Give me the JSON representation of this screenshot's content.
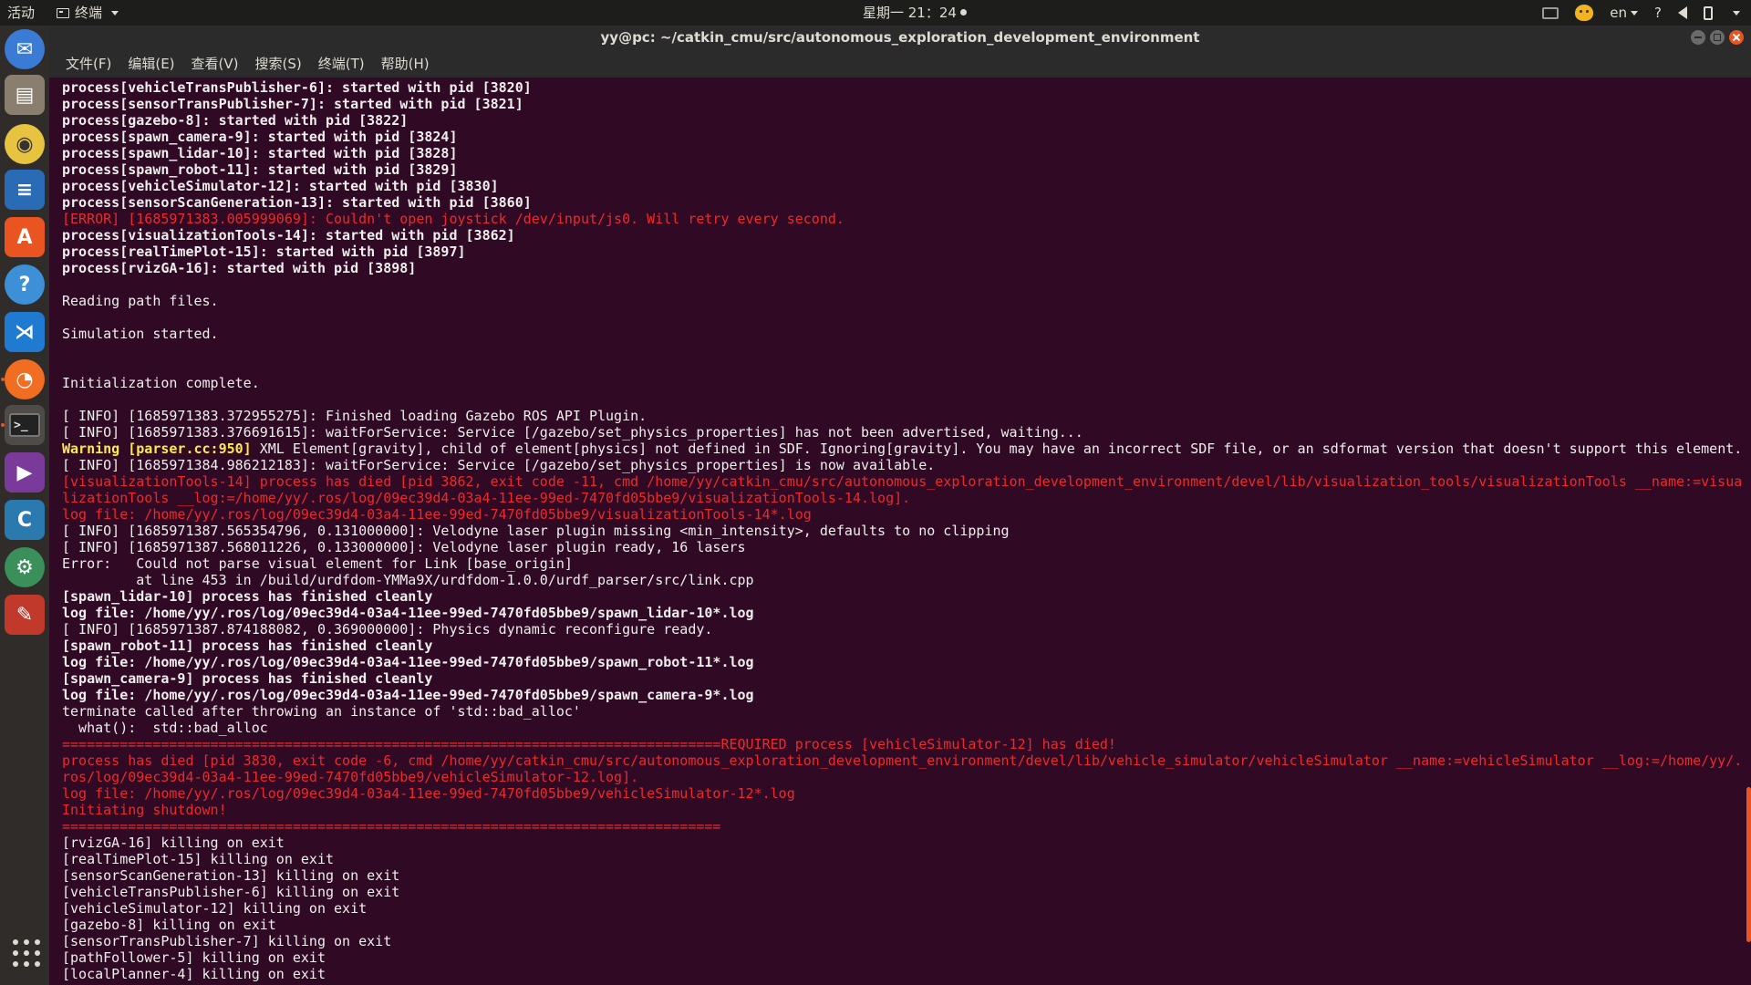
{
  "top_panel": {
    "activities": "活动",
    "app_name": "终端",
    "clock": "星期一 21：24",
    "input_method": "en",
    "help_symbol": "?"
  },
  "dock": {
    "items": [
      {
        "name": "thunderbird-icon",
        "color": "#3a7bd5"
      },
      {
        "name": "files-icon",
        "color": "#8a7f6f"
      },
      {
        "name": "rhythmbox-icon",
        "color": "#e8c340"
      },
      {
        "name": "libreoffice-writer-icon",
        "color": "#2a6bb5"
      },
      {
        "name": "software-center-icon",
        "color": "#e95420"
      },
      {
        "name": "help-icon",
        "color": "#3d8fd8"
      },
      {
        "name": "vscode-icon",
        "color": "#1f7bd1"
      },
      {
        "name": "firefox-icon",
        "color": "#f06d22"
      },
      {
        "name": "terminal-icon",
        "color": "#222222"
      },
      {
        "name": "video-app-icon",
        "color": "#7a3a9a"
      },
      {
        "name": "c-app-icon",
        "color": "#2a7ab0"
      },
      {
        "name": "settings-icon",
        "color": "#3a8f5a"
      },
      {
        "name": "tools-icon",
        "color": "#c0392b"
      }
    ],
    "show_apps": "show-applications"
  },
  "window": {
    "title": "yy@pc: ~/catkin_cmu/src/autonomous_exploration_development_environment"
  },
  "menu": [
    "文件(F)",
    "编辑(E)",
    "查看(V)",
    "搜索(S)",
    "终端(T)",
    "帮助(H)"
  ],
  "terminal": {
    "lines": [
      {
        "text": "process[vehicleTransPublisher-6]: started with pid [3820]",
        "style": "bold"
      },
      {
        "text": "process[sensorTransPublisher-7]: started with pid [3821]",
        "style": "bold"
      },
      {
        "text": "process[gazebo-8]: started with pid [3822]",
        "style": "bold"
      },
      {
        "text": "process[spawn_camera-9]: started with pid [3824]",
        "style": "bold"
      },
      {
        "text": "process[spawn_lidar-10]: started with pid [3828]",
        "style": "bold"
      },
      {
        "text": "process[spawn_robot-11]: started with pid [3829]",
        "style": "bold"
      },
      {
        "text": "process[vehicleSimulator-12]: started with pid [3830]",
        "style": "bold"
      },
      {
        "text": "process[sensorScanGeneration-13]: started with pid [3860]",
        "style": "bold"
      },
      {
        "text": "[ERROR] [1685971383.005999069]: Couldn't open joystick /dev/input/js0. Will retry every second.",
        "style": "err"
      },
      {
        "text": "process[visualizationTools-14]: started with pid [3862]",
        "style": "bold"
      },
      {
        "text": "process[realTimePlot-15]: started with pid [3897]",
        "style": "bold"
      },
      {
        "text": "process[rvizGA-16]: started with pid [3898]",
        "style": "bold"
      },
      {
        "text": "",
        "style": ""
      },
      {
        "text": "Reading path files.",
        "style": ""
      },
      {
        "text": "",
        "style": ""
      },
      {
        "text": "Simulation started.",
        "style": ""
      },
      {
        "text": "",
        "style": ""
      },
      {
        "text": "",
        "style": ""
      },
      {
        "text": "Initialization complete.",
        "style": ""
      },
      {
        "text": "",
        "style": ""
      },
      {
        "text": "[ INFO] [1685971383.372955275]: Finished loading Gazebo ROS API Plugin.",
        "style": ""
      },
      {
        "text": "[ INFO] [1685971383.376691615]: waitForService: Service [/gazebo/set_physics_properties] has not been advertised, waiting...",
        "style": ""
      },
      {
        "text": " XML Element[gravity], child of element[physics] not defined in SDF. Ignoring[gravity]. You may have an incorrect SDF file, or an sdformat version that doesn't support this element.",
        "style": "warn",
        "prefix": "Warning [parser.cc:950]"
      },
      {
        "text": "[ INFO] [1685971384.986212183]: waitForService: Service [/gazebo/set_physics_properties] is now available.",
        "style": ""
      },
      {
        "text": "[visualizationTools-14] process has died [pid 3862, exit code -11, cmd /home/yy/catkin_cmu/src/autonomous_exploration_development_environment/devel/lib/visualization_tools/visualizationTools __name:=visua",
        "style": "err"
      },
      {
        "text": "lizationTools __log:=/home/yy/.ros/log/09ec39d4-03a4-11ee-99ed-7470fd05bbe9/visualizationTools-14.log].",
        "style": "err"
      },
      {
        "text": "log file: /home/yy/.ros/log/09ec39d4-03a4-11ee-99ed-7470fd05bbe9/visualizationTools-14*.log",
        "style": "err"
      },
      {
        "text": "[ INFO] [1685971387.565354796, 0.131000000]: Velodyne laser plugin missing <min_intensity>, defaults to no clipping",
        "style": ""
      },
      {
        "text": "[ INFO] [1685971387.568011226, 0.133000000]: Velodyne laser plugin ready, 16 lasers",
        "style": ""
      },
      {
        "text": "Error:   Could not parse visual element for Link [base_origin]",
        "style": ""
      },
      {
        "text": "         at line 453 in /build/urdfdom-YMMa9X/urdfdom-1.0.0/urdf_parser/src/link.cpp",
        "style": ""
      },
      {
        "text": "[spawn_lidar-10] process has finished cleanly",
        "style": "bold"
      },
      {
        "text": "log file: /home/yy/.ros/log/09ec39d4-03a4-11ee-99ed-7470fd05bbe9/spawn_lidar-10*.log",
        "style": "bold"
      },
      {
        "text": "[ INFO] [1685971387.874188082, 0.369000000]: Physics dynamic reconfigure ready.",
        "style": ""
      },
      {
        "text": "[spawn_robot-11] process has finished cleanly",
        "style": "bold"
      },
      {
        "text": "log file: /home/yy/.ros/log/09ec39d4-03a4-11ee-99ed-7470fd05bbe9/spawn_robot-11*.log",
        "style": "bold"
      },
      {
        "text": "[spawn_camera-9] process has finished cleanly",
        "style": "bold"
      },
      {
        "text": "log file: /home/yy/.ros/log/09ec39d4-03a4-11ee-99ed-7470fd05bbe9/spawn_camera-9*.log",
        "style": "bold"
      },
      {
        "text": "terminate called after throwing an instance of 'std::bad_alloc'",
        "style": ""
      },
      {
        "text": "  what():  std::bad_alloc",
        "style": ""
      },
      {
        "text": "================================================================================REQUIRED process [vehicleSimulator-12] has died!",
        "style": "err"
      },
      {
        "text": "process has died [pid 3830, exit code -6, cmd /home/yy/catkin_cmu/src/autonomous_exploration_development_environment/devel/lib/vehicle_simulator/vehicleSimulator __name:=vehicleSimulator __log:=/home/yy/.",
        "style": "err"
      },
      {
        "text": "ros/log/09ec39d4-03a4-11ee-99ed-7470fd05bbe9/vehicleSimulator-12.log].",
        "style": "err"
      },
      {
        "text": "log file: /home/yy/.ros/log/09ec39d4-03a4-11ee-99ed-7470fd05bbe9/vehicleSimulator-12*.log",
        "style": "err"
      },
      {
        "text": "Initiating shutdown!",
        "style": "err"
      },
      {
        "text": "================================================================================",
        "style": "err"
      },
      {
        "text": "[rvizGA-16] killing on exit",
        "style": ""
      },
      {
        "text": "[realTimePlot-15] killing on exit",
        "style": ""
      },
      {
        "text": "[sensorScanGeneration-13] killing on exit",
        "style": ""
      },
      {
        "text": "[vehicleTransPublisher-6] killing on exit",
        "style": ""
      },
      {
        "text": "[vehicleSimulator-12] killing on exit",
        "style": ""
      },
      {
        "text": "[gazebo-8] killing on exit",
        "style": ""
      },
      {
        "text": "[sensorTransPublisher-7] killing on exit",
        "style": ""
      },
      {
        "text": "[pathFollower-5] killing on exit",
        "style": ""
      },
      {
        "text": "[localPlanner-4] killing on exit",
        "style": ""
      }
    ]
  },
  "colors": {
    "terminal_bg": "#300a24",
    "error_text": "#ef2929",
    "warning_text": "#fce94f",
    "accent": "#e95420"
  }
}
